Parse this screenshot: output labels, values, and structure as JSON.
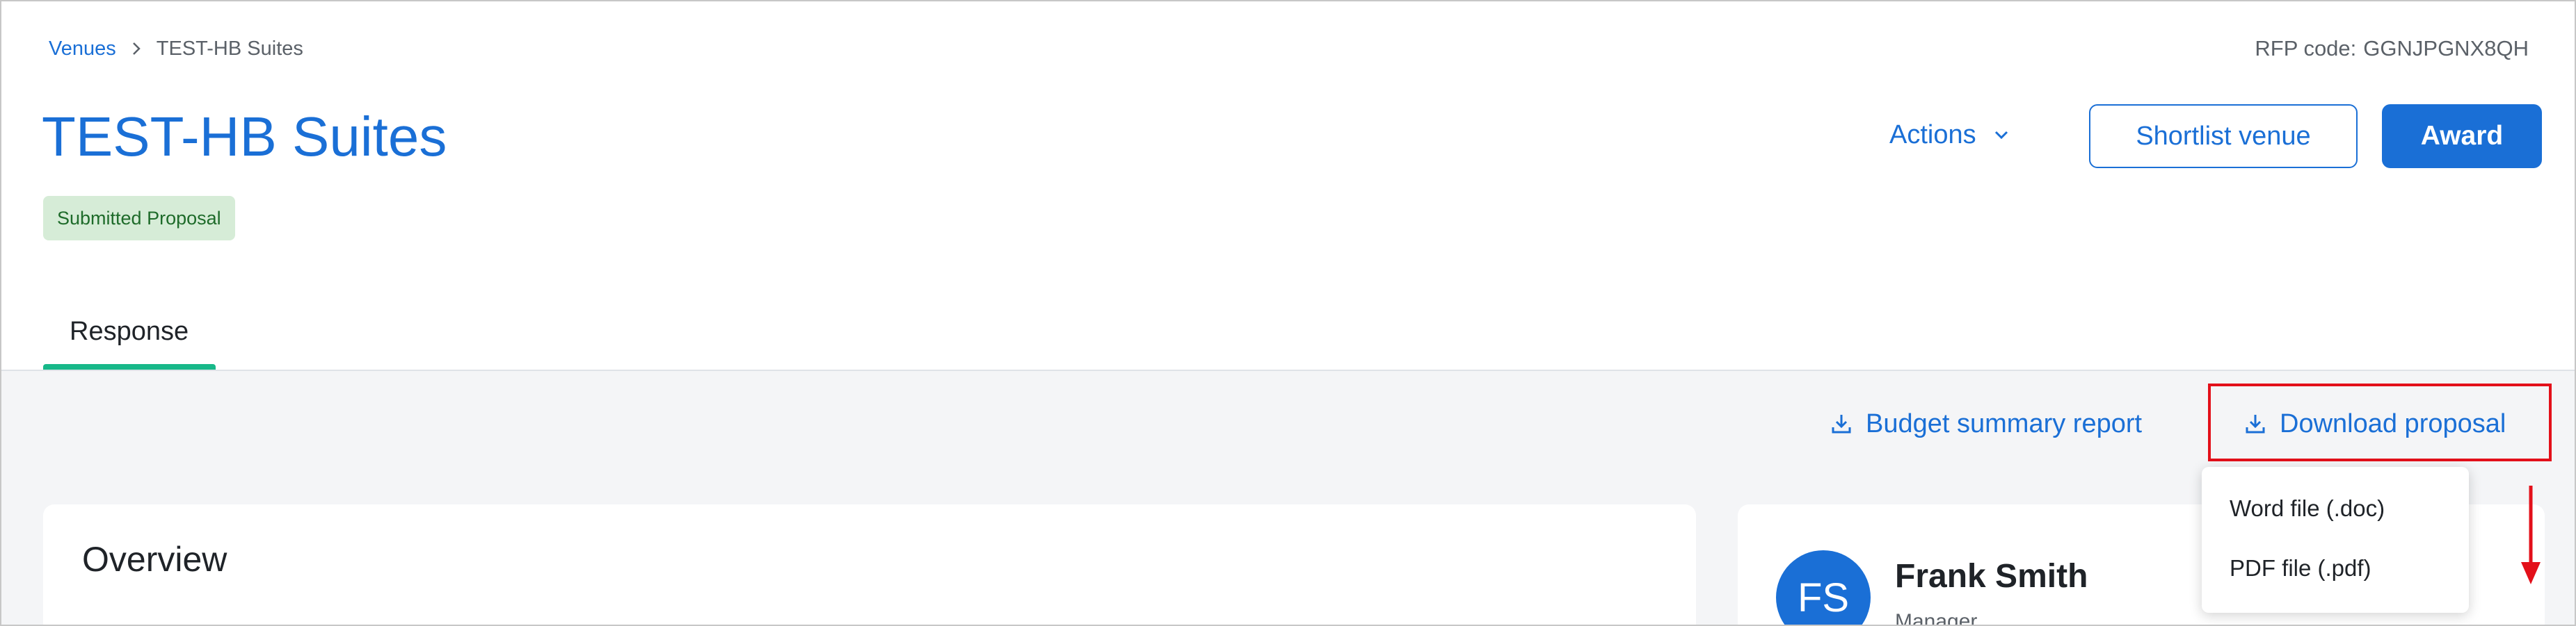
{
  "breadcrumb": {
    "root": "Venues",
    "current": "TEST-HB Suites"
  },
  "rfp": {
    "label": "RFP code:",
    "code": "GGNJPGNX8QH"
  },
  "page": {
    "title": "TEST-HB Suites",
    "status": "Submitted Proposal"
  },
  "header_actions": {
    "actions_label": "Actions",
    "shortlist_label": "Shortlist venue",
    "award_label": "Award"
  },
  "tabs": [
    {
      "label": "Response",
      "active": true
    }
  ],
  "toolbar": {
    "budget_label": "Budget summary report",
    "download_label": "Download proposal"
  },
  "download_menu": {
    "items": [
      {
        "label": "Word file (.doc)"
      },
      {
        "label": "PDF file (.pdf)"
      }
    ]
  },
  "overview": {
    "title": "Overview"
  },
  "contact": {
    "initials": "FS",
    "name": "Frank Smith",
    "role": "Manager"
  },
  "colors": {
    "accent": "#1a6fd6",
    "tab_indicator": "#17b889",
    "badge_bg": "#d6ecd7",
    "badge_text": "#1e6b2a",
    "annotation": "#e3101a"
  },
  "icons": [
    "chevron-right-icon",
    "chevron-down-icon",
    "download-icon",
    "arrow-down-icon"
  ]
}
